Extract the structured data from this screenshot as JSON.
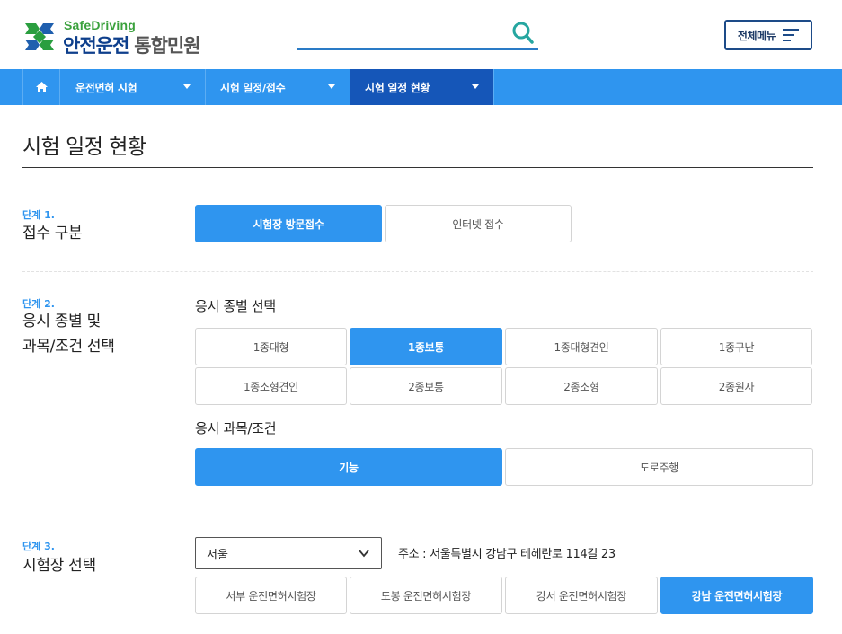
{
  "header": {
    "logo_sub": "SafeDriving",
    "logo_main": "안전운전",
    "logo_main_gray": "통합민원",
    "search_value": "",
    "menu_label": "전체메뉴"
  },
  "nav": {
    "items": [
      {
        "label": "운전면허 시험"
      },
      {
        "label": "시험 일정/접수"
      },
      {
        "label": "시험 일정 현황"
      }
    ]
  },
  "page": {
    "title": "시험 일정 현황"
  },
  "step1": {
    "num": "단계 1.",
    "title": "접수 구분",
    "options": [
      "시험장 방문접수",
      "인터넷 접수"
    ],
    "selected": "시험장 방문접수"
  },
  "step2": {
    "num": "단계 2.",
    "title_line1": "응시 종별 및",
    "title_line2": "과목/조건 선택",
    "type_label": "응시 종별 선택",
    "types": [
      "1종대형",
      "1종보통",
      "1종대형견인",
      "1종구난",
      "1종소형견인",
      "2종보통",
      "2종소형",
      "2종원자"
    ],
    "type_selected": "1종보통",
    "subject_label": "응시 과목/조건",
    "subjects": [
      "기능",
      "도로주행"
    ],
    "subject_selected": "기능"
  },
  "step3": {
    "num": "단계 3.",
    "title": "시험장 선택",
    "region": "서울",
    "address": "주소 : 서울특별시 강남구 테헤란로 114길 23",
    "centers": [
      "서부 운전면허시험장",
      "도봉 운전면허시험장",
      "강서 운전면허시험장",
      "강남 운전면허시험장"
    ],
    "center_selected": "강남 운전면허시험장"
  },
  "colors": {
    "accent": "#2f95ef",
    "nav_active": "#1556b8",
    "logo_green": "#3aa13c",
    "logo_navy": "#0e3f8c"
  }
}
